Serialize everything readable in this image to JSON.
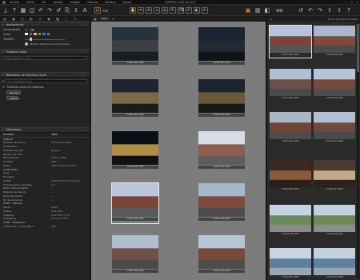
{
  "menubar": {
    "menus": [
      "Archivo",
      "Editar",
      "Ver",
      "Ajustes",
      "Imagen",
      "Cámara",
      "Ventana",
      "Ayuda"
    ],
    "title": "CARPETA 1264 con 254",
    "controls": [
      "—",
      "□",
      "✕"
    ]
  },
  "annotations": {
    "header": "Anotaciones",
    "tool_label": "Herramienta",
    "color_label": "Color",
    "colors": [
      "#ffffff",
      "#e03030",
      "#f0d000",
      "#30c030",
      "#3070e0",
      "#c040c0"
    ],
    "size_label": "Tamaño",
    "show_always": "Mostrar Siempre las Anotaciones"
  },
  "keywords": {
    "header": "Palabras clave",
    "placeholder": "Añadir palabras clave"
  },
  "keyword_library": {
    "header": "Biblioteca de Palabras clave",
    "filter_placeholder": "Filtro Palabras clave",
    "catalog_label": "Palabras clave de Catálogo",
    "chip1": "Ejemplo",
    "chip2": "catálogo"
  },
  "metadata": {
    "header": "Metadatos",
    "col_name": "Nombre",
    "col_value": "Valor",
    "rows": [
      {
        "k": "▾ Básico",
        "v": "",
        "grp": true
      },
      {
        "k": "Nombre de archivo",
        "v": "D1264-005.ARW"
      },
      {
        "k": "Calificación",
        "v": "· · · · ·"
      },
      {
        "k": "Etiqueta de color",
        "v": "Ninguno"
      },
      {
        "k": "Espacio de color",
        "v": ""
      },
      {
        "k": "Dimensiones",
        "v": "6000 x 4000"
      },
      {
        "k": "Formato",
        "v": "RAW"
      },
      {
        "k": "Fecha",
        "v": "18/07/2016 21:09:31"
      },
      {
        "k": "▾ Fabricante",
        "v": "",
        "grp": true
      },
      {
        "k": "Serie",
        "v": "—"
      },
      {
        "k": "Firmware",
        "v": "—"
      },
      {
        "k": "Lentes",
        "v": "FE 28-70mm F4 ZA OSS"
      },
      {
        "k": "Compensación del flash",
        "v": "0.0"
      },
      {
        "k": "Modo captura/digital",
        "v": "—"
      },
      {
        "k": "Balance de blancos",
        "v": "—"
      },
      {
        "k": "ID de Secuencia",
        "v": "—"
      },
      {
        "k": "Nº de secuencia",
        "v": "—"
      },
      {
        "k": "▾ EXIF - Cámara",
        "v": "",
        "grp": true
      },
      {
        "k": "Marca",
        "v": "SONY"
      },
      {
        "k": "Modelo",
        "v": "ILCE-7M3"
      },
      {
        "k": "Software",
        "v": "ILCE-7M3 v1.01"
      },
      {
        "k": "Propietario",
        "v": "Oscar_Cordón"
      },
      {
        "k": "▾ EXIF - Exposición",
        "v": "",
        "grp": true
      },
      {
        "k": "Calificación y velocidad 1",
        "v": "400"
      }
    ]
  },
  "center": {
    "tab": "Todo",
    "images": [
      {
        "name": "D1264-001.ARW",
        "colors": [
          "#26323c",
          "#3c4046",
          "#1a1d22"
        ]
      },
      {
        "name": "D1264-003.ARW",
        "colors": [
          "#1b2431",
          "#232a33",
          "#0f1216"
        ]
      },
      {
        "name": "D1264-001.ARW",
        "colors": [
          "#1e2530",
          "#7a6a44",
          "#1b1b1b"
        ]
      },
      {
        "name": "D1264-006.ARW",
        "colors": [
          "#1c2430",
          "#6b5a3a",
          "#181818"
        ]
      },
      {
        "name": "D1264-007.ARW",
        "colors": [
          "#0c1016",
          "#ad8e44",
          "#111"
        ]
      },
      {
        "name": "D1264-008.ARW",
        "colors": [
          "#d7dde4",
          "#8b5e50",
          "#5c5c5c"
        ]
      },
      {
        "name": "D1264-005.ARW",
        "colors": [
          "#b8c6d8",
          "#7a4538",
          "#5a5a5a"
        ]
      },
      {
        "name": "D1264-008.ARW",
        "colors": [
          "#a8b8ca",
          "#7d4b3e",
          "#4c4c4c"
        ]
      },
      {
        "name": "D1264-009.ARW",
        "colors": [
          "#b0bed0",
          "#6d5048",
          "#4a4a4a"
        ]
      },
      {
        "name": "D1264-010.ARW",
        "colors": [
          "#b5c4d6",
          "#784a3c",
          "#4d4d4d"
        ]
      }
    ]
  },
  "browser": {
    "count": "35 de 254 seleccionadas",
    "images": [
      {
        "name": "D1264-005.ARW",
        "colors": [
          "#b4c4d6",
          "#7a4538",
          "#555"
        ]
      },
      {
        "name": "D1264-006.ARW",
        "colors": [
          "#a8b8ca",
          "#7d4b3e",
          "#4c4c4c"
        ]
      },
      {
        "name": "D1264-009.ARW",
        "colors": [
          "#b0bed0",
          "#6d5048",
          "#4a4a4a"
        ]
      },
      {
        "name": "D1264-010.ARW",
        "colors": [
          "#b5c4d6",
          "#784a3c",
          "#4d4d4d"
        ]
      },
      {
        "name": "D1264-011.ARW",
        "colors": [
          "#a8b6c6",
          "#744438",
          "#4c4c4c"
        ]
      },
      {
        "name": "D1264-012.ARW",
        "colors": [
          "#b2c0d2",
          "#6c4a3e",
          "#4a4a4a"
        ]
      },
      {
        "name": "D1264-013.ARW",
        "colors": [
          "#3a2a22",
          "#8a5a3c",
          "#2a1e18"
        ]
      },
      {
        "name": "D1264-014.ARW",
        "colors": [
          "#4a3a30",
          "#c0a888",
          "#2a221c"
        ]
      },
      {
        "name": "D1264-015.ARW",
        "colors": [
          "#c6d4e2",
          "#6a8a5a",
          "#8a8a8a"
        ]
      },
      {
        "name": "D1264-016.ARW",
        "colors": [
          "#c2d0de",
          "#6c8a58",
          "#8c8c8c"
        ]
      },
      {
        "name": "D1264-017.ARW",
        "colors": [
          "#c8d6e4",
          "#5e7ea0",
          "#9aa6b0"
        ]
      },
      {
        "name": "D1264-018.ARW",
        "colors": [
          "#c4d2e0",
          "#6080a2",
          "#98a4ae"
        ]
      }
    ]
  },
  "toolbar_icons": [
    "import-icon",
    "export-icon",
    "grid-icon",
    "undo-icon",
    "redo-icon",
    "copy-icon",
    "paste-icon",
    "text-icon"
  ]
}
